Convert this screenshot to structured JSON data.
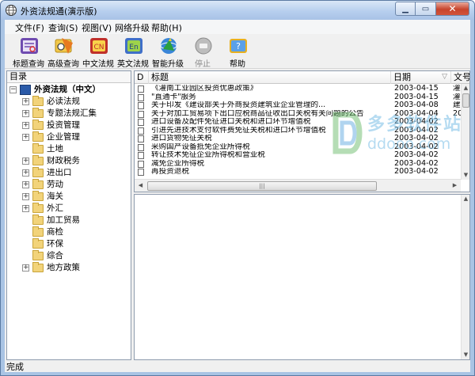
{
  "window": {
    "title": "外资法规通(演示版)",
    "controls": {
      "minimize": "▁",
      "maximize": "▭",
      "close": "✕"
    }
  },
  "menu": [
    {
      "label": "文件(F)"
    },
    {
      "label": "查询(S)"
    },
    {
      "label": "视图(V)"
    },
    {
      "label": "网络升级"
    },
    {
      "label": "帮助(H)"
    }
  ],
  "toolbar": [
    {
      "label": "标题查询",
      "icon": "title-search-icon",
      "color": "#6f4bb0"
    },
    {
      "label": "高级查询",
      "icon": "advanced-search-icon",
      "color": "#e0a020"
    },
    {
      "label": "中文法规",
      "icon": "chinese-law-icon",
      "color": "#c0302a"
    },
    {
      "label": "英文法规",
      "icon": "english-law-icon",
      "color": "#3f6fc8"
    },
    {
      "label": "智能升级",
      "icon": "smart-upgrade-icon",
      "color": "#2aa040"
    },
    {
      "label": "停止",
      "icon": "stop-icon",
      "color": "#9a9a9a",
      "disabled": true
    },
    {
      "label": "帮助",
      "icon": "help-icon",
      "color": "#e8b020"
    }
  ],
  "tree": {
    "header": "目录",
    "root": "外资法规（中文）",
    "items": [
      {
        "label": "必读法规",
        "expandable": true
      },
      {
        "label": "专题法规汇集",
        "expandable": true
      },
      {
        "label": "投资管理",
        "expandable": true
      },
      {
        "label": "企业管理",
        "expandable": true
      },
      {
        "label": "土地",
        "expandable": false
      },
      {
        "label": "财政税务",
        "expandable": true
      },
      {
        "label": "进出口",
        "expandable": true
      },
      {
        "label": "劳动",
        "expandable": true
      },
      {
        "label": "海关",
        "expandable": true
      },
      {
        "label": "外汇",
        "expandable": true
      },
      {
        "label": "加工贸易",
        "expandable": false
      },
      {
        "label": "商检",
        "expandable": false
      },
      {
        "label": "环保",
        "expandable": false
      },
      {
        "label": "综合",
        "expandable": false
      },
      {
        "label": "地方政策",
        "expandable": true
      }
    ]
  },
  "list": {
    "columns": {
      "icon": "D",
      "title": "标题",
      "date": "日期",
      "sort": "▽",
      "number": "文号"
    },
    "rows": [
      {
        "title": "《灌南工业园区投资优惠政策》",
        "date": "2003-04-15",
        "number": "灌"
      },
      {
        "title": "\"直通卡\"服务",
        "date": "2003-04-15",
        "number": "灌"
      },
      {
        "title": "关于印发《建设部关于外商投资建筑业企业管理的...",
        "date": "2003-04-08",
        "number": "建市"
      },
      {
        "title": "关于对加工贸易项下出口应税商品征收出口关税有关问题的公告",
        "date": "2003-04-04",
        "number": "20"
      },
      {
        "title": "进口设备及配件免征进口关税和进口环节增值税",
        "date": "2003-04-02",
        "number": ""
      },
      {
        "title": "引进先进技术支付软件费免征关税和进口环节增值税",
        "date": "2003-04-02",
        "number": ""
      },
      {
        "title": "进口货物免征关税",
        "date": "2003-04-02",
        "number": ""
      },
      {
        "title": "采购国产设备抵免企业所得税",
        "date": "2003-04-02",
        "number": ""
      },
      {
        "title": "转让技术免征企业所得税和营业税",
        "date": "2003-04-02",
        "number": ""
      },
      {
        "title": "减免企业所得税",
        "date": "2003-04-02",
        "number": ""
      },
      {
        "title": "再投资退税",
        "date": "2003-04-02",
        "number": ""
      }
    ]
  },
  "watermark": {
    "main": "多多软件站",
    "sub": "ddooo.com"
  },
  "status": "完成"
}
